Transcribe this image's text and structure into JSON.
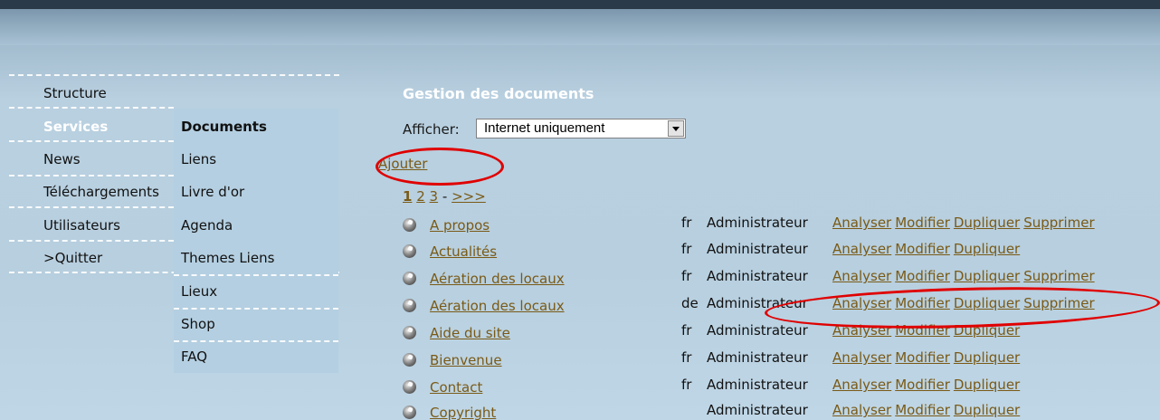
{
  "nav": {
    "items": [
      {
        "label": "Structure"
      },
      {
        "label": "Services",
        "active": true
      },
      {
        "label": "News"
      },
      {
        "label": "Téléchargements"
      },
      {
        "label": "Utilisateurs"
      },
      {
        "label": ">Quitter"
      }
    ]
  },
  "subnav": {
    "items": [
      {
        "label": "Documents",
        "active": true
      },
      {
        "label": "Liens"
      },
      {
        "label": "Livre d'or"
      },
      {
        "label": "Agenda"
      },
      {
        "label": "Themes Liens"
      },
      {
        "label": "Lieux"
      },
      {
        "label": "Shop"
      },
      {
        "label": "FAQ"
      }
    ]
  },
  "main": {
    "title": "Gestion des documents",
    "filter_label": "Afficher:",
    "filter_value": "Internet uniquement",
    "add_label": "Ajouter",
    "pager": {
      "current": "1",
      "pages": [
        "2",
        "3"
      ],
      "separator": "-",
      "next": ">>>"
    },
    "documents": [
      {
        "name": "A propos",
        "lang": "fr",
        "author": "Administrateur",
        "actions": [
          "Analyser",
          "Modifier",
          "Dupliquer",
          "Supprimer"
        ]
      },
      {
        "name": "Actualités",
        "lang": "fr",
        "author": "Administrateur",
        "actions": [
          "Analyser",
          "Modifier",
          "Dupliquer"
        ]
      },
      {
        "name": "Aération des locaux",
        "lang": "fr",
        "author": "Administrateur",
        "actions": [
          "Analyser",
          "Modifier",
          "Dupliquer",
          "Supprimer"
        ]
      },
      {
        "name": "Aération des locaux",
        "lang": "de",
        "author": "Administrateur",
        "actions": [
          "Analyser",
          "Modifier",
          "Dupliquer",
          "Supprimer"
        ]
      },
      {
        "name": "Aide du site",
        "lang": "fr",
        "author": "Administrateur",
        "actions": [
          "Analyser",
          "Modifier",
          "Dupliquer"
        ]
      },
      {
        "name": "Bienvenue",
        "lang": "fr",
        "author": "Administrateur",
        "actions": [
          "Analyser",
          "Modifier",
          "Dupliquer"
        ]
      },
      {
        "name": "Contact",
        "lang": "fr",
        "author": "Administrateur",
        "actions": [
          "Analyser",
          "Modifier",
          "Dupliquer"
        ]
      },
      {
        "name": "Copyright",
        "lang": "",
        "author": "Administrateur",
        "actions": [
          "Analyser",
          "Modifier",
          "Dupliquer"
        ]
      }
    ]
  },
  "colors": {
    "link": "#7a5a16",
    "annotation": "#e00000",
    "title": "#ffffff",
    "background": "#b9d0e0"
  }
}
